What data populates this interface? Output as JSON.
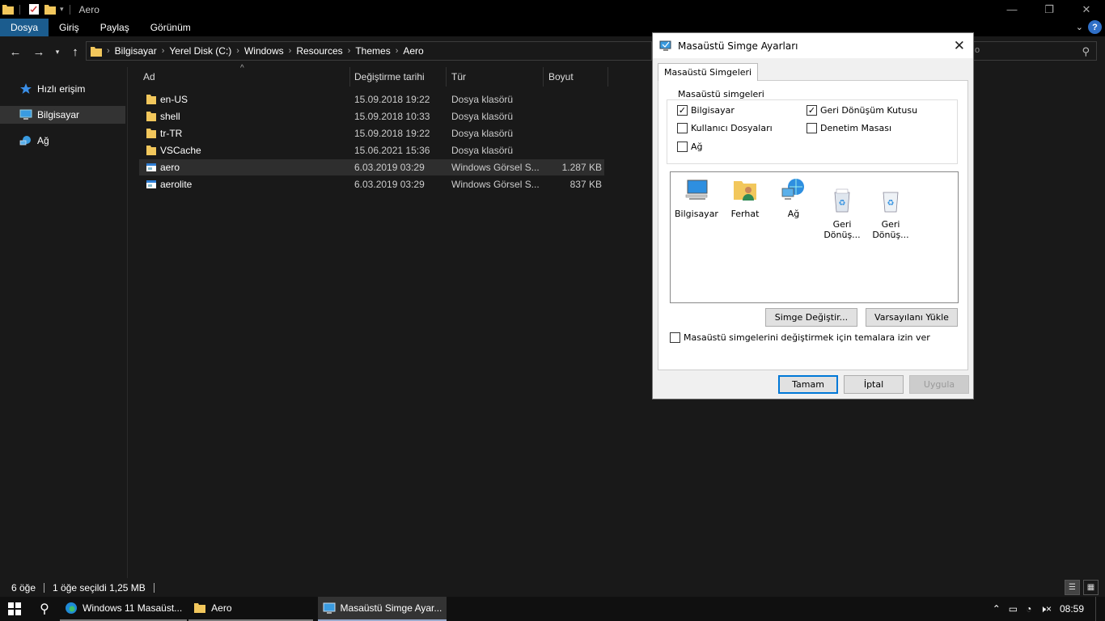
{
  "window": {
    "title": "Aero",
    "minimize": "—",
    "restore": "❐",
    "close": "✕"
  },
  "ribbon": {
    "tabs": [
      "Dosya",
      "Giriş",
      "Paylaş",
      "Görünüm"
    ],
    "help": "?"
  },
  "address": {
    "crumbs": [
      "Bilgisayar",
      "Yerel Disk (C:)",
      "Windows",
      "Resources",
      "Themes",
      "Aero"
    ],
    "search_placeholder": "o"
  },
  "sidebar": {
    "items": [
      {
        "label": "Hızlı erişim",
        "icon": "star-icon"
      },
      {
        "label": "Bilgisayar",
        "icon": "computer-icon"
      },
      {
        "label": "Ağ",
        "icon": "network-icon"
      }
    ]
  },
  "filelist": {
    "columns": [
      "Ad",
      "Değiştirme tarihi",
      "Tür",
      "Boyut"
    ],
    "rows": [
      {
        "name": "en-US",
        "date": "15.09.2018 19:22",
        "type": "Dosya klasörü",
        "size": "",
        "kind": "folder"
      },
      {
        "name": "shell",
        "date": "15.09.2018 10:33",
        "type": "Dosya klasörü",
        "size": "",
        "kind": "folder"
      },
      {
        "name": "tr-TR",
        "date": "15.09.2018 19:22",
        "type": "Dosya klasörü",
        "size": "",
        "kind": "folder"
      },
      {
        "name": "VSCache",
        "date": "15.06.2021 15:36",
        "type": "Dosya klasörü",
        "size": "",
        "kind": "folder"
      },
      {
        "name": "aero",
        "date": "6.03.2019 03:29",
        "type": "Windows Görsel S...",
        "size": "1.287 KB",
        "kind": "theme"
      },
      {
        "name": "aerolite",
        "date": "6.03.2019 03:29",
        "type": "Windows Görsel S...",
        "size": "837 KB",
        "kind": "theme"
      }
    ]
  },
  "status": {
    "count": "6 öğe",
    "selection": "1 öğe seçildi  1,25 MB"
  },
  "taskbar": {
    "apps": [
      {
        "label": "Windows 11 Masaüst...",
        "icon": "edge-icon"
      },
      {
        "label": "Aero",
        "icon": "folder-icon"
      },
      {
        "label": "Masaüstü Simge Ayar...",
        "icon": "desktop-settings-icon"
      }
    ],
    "time": "08:59"
  },
  "dialog": {
    "title": "Masaüstü Simge Ayarları",
    "tab": "Masaüstü Simgeleri",
    "group_label": "Masaüstü simgeleri",
    "checkboxes": [
      {
        "label": "Bilgisayar",
        "checked": true
      },
      {
        "label": "Geri Dönüşüm Kutusu",
        "checked": true
      },
      {
        "label": "Kullanıcı Dosyaları",
        "checked": false
      },
      {
        "label": "Denetim Masası",
        "checked": false
      },
      {
        "label": "Ağ",
        "checked": false
      }
    ],
    "icons": [
      {
        "label": "Bilgisayar",
        "icon": "computer-icon"
      },
      {
        "label": "Ferhat",
        "icon": "user-folder-icon"
      },
      {
        "label": "Ağ",
        "icon": "network-icon"
      },
      {
        "label": "Geri\nDönüş...",
        "icon": "recycle-bin-full-icon"
      },
      {
        "label": "Geri\nDönüş...",
        "icon": "recycle-bin-empty-icon"
      }
    ],
    "change_icon": "Simge Değiştir...",
    "restore_default": "Varsayılanı Yükle",
    "allow_themes": "Masaüstü simgelerini değiştirmek için temalara izin ver",
    "allow_themes_checked": false,
    "ok": "Tamam",
    "cancel": "İptal",
    "apply": "Uygula"
  }
}
